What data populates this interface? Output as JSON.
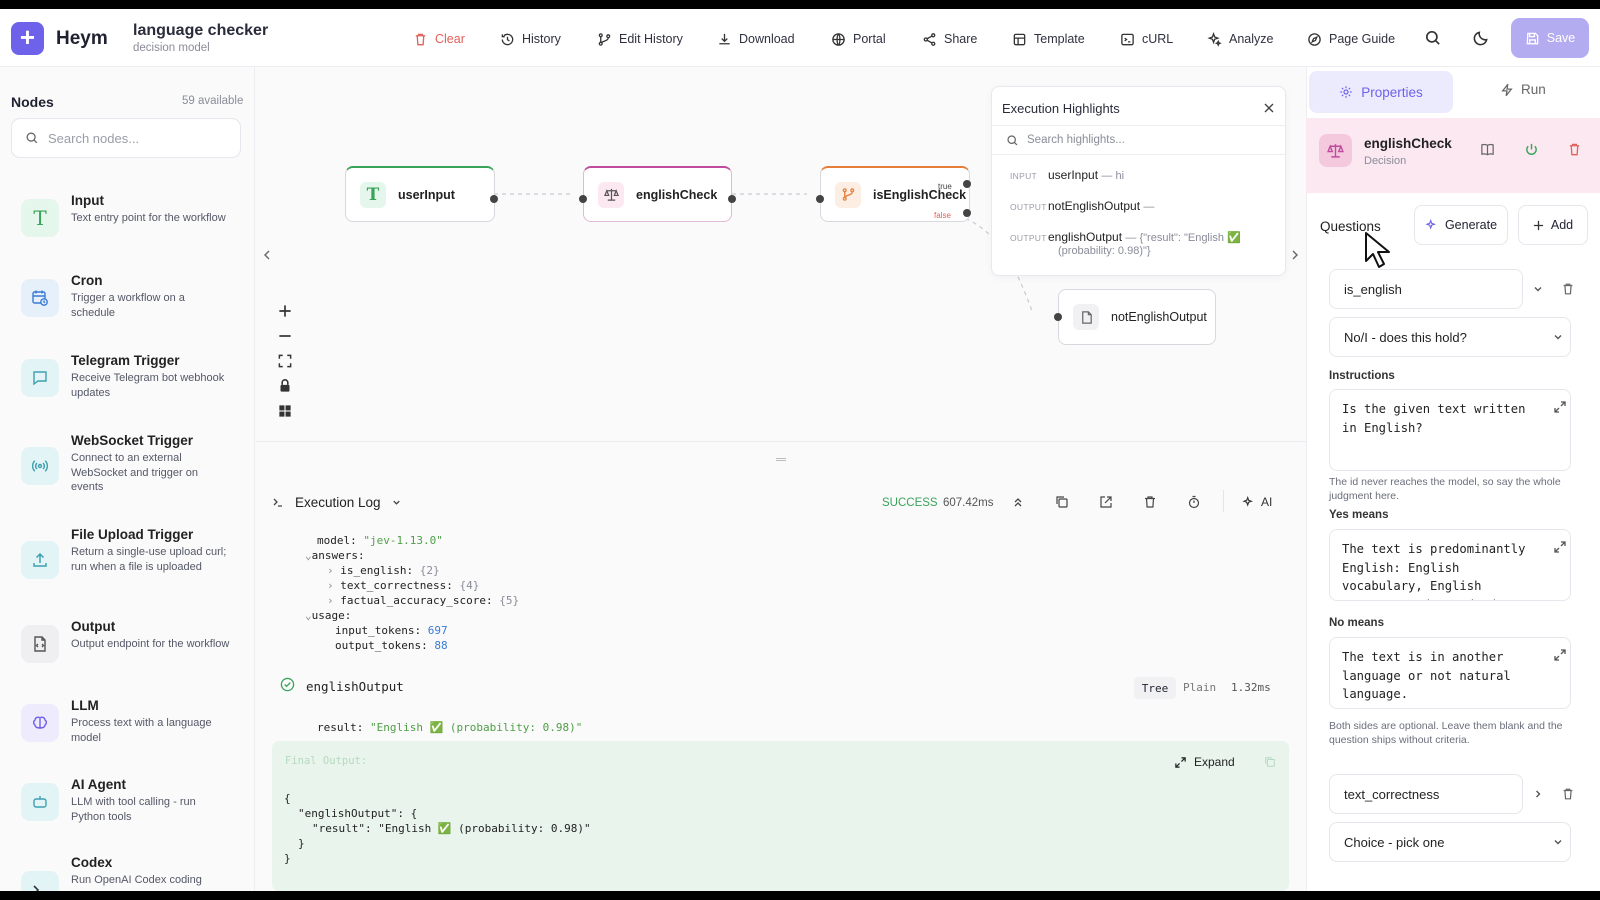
{
  "header": {
    "brand": "Heym",
    "workflow_title": "language checker",
    "workflow_subtitle": "decision model",
    "toolbar": {
      "clear": "Clear",
      "history": "History",
      "edit_history": "Edit History",
      "download": "Download",
      "portal": "Portal",
      "share": "Share",
      "template": "Template",
      "curl": "cURL",
      "analyze": "Analyze",
      "page_guide": "Page Guide",
      "save": "Save"
    }
  },
  "sidebar": {
    "title": "Nodes",
    "count": "59 available",
    "search_placeholder": "Search nodes...",
    "nodes": [
      {
        "title": "Input",
        "desc": "Text entry point for the workflow",
        "icon": "text-icon"
      },
      {
        "title": "Cron",
        "desc": "Trigger a workflow on a schedule",
        "icon": "calendar-clock-icon"
      },
      {
        "title": "Telegram Trigger",
        "desc": "Receive Telegram bot webhook updates",
        "icon": "chat-icon"
      },
      {
        "title": "WebSocket Trigger",
        "desc": "Connect to an external WebSocket and trigger on events",
        "icon": "broadcast-icon"
      },
      {
        "title": "File Upload Trigger",
        "desc": "Return a single-use upload curl; run when a file is uploaded",
        "icon": "upload-icon"
      },
      {
        "title": "Output",
        "desc": "Output endpoint for the workflow",
        "icon": "file-icon"
      },
      {
        "title": "LLM",
        "desc": "Process text with a language model",
        "icon": "brain-icon"
      },
      {
        "title": "AI Agent",
        "desc": "LLM with tool calling - run Python tools",
        "icon": "bot-icon"
      },
      {
        "title": "Codex",
        "desc": "Run OpenAI Codex coding",
        "icon": "terminal-icon"
      }
    ]
  },
  "canvas": {
    "nodes": {
      "user_input": "userInput",
      "english_check": "englishCheck",
      "is_english_check": "isEnglishCheck",
      "not_english_output": "notEnglishOutput"
    },
    "branch_true": "true",
    "branch_false": "false"
  },
  "highlights": {
    "title": "Execution Highlights",
    "search_placeholder": "Search highlights...",
    "rows": [
      {
        "kind": "INPUT",
        "name": "userInput",
        "value": "— hi"
      },
      {
        "kind": "OUTPUT",
        "name": "notEnglishOutput",
        "value": "—"
      },
      {
        "kind": "OUTPUT",
        "name": "englishOutput",
        "value": "— {\"result\": \"English ✅",
        "value2": "(probability: 0.98)\"}"
      }
    ]
  },
  "log": {
    "title": "Execution Log",
    "status": "SUCCESS",
    "duration": "607.42ms",
    "ai": "AI",
    "tree": {
      "model_key": "model:",
      "model_val": "\"jev-1.13.0\"",
      "answers_key": "answers:",
      "a1_key": "is_english:",
      "a1_val": "{2}",
      "a2_key": "text_correctness:",
      "a2_val": "{4}",
      "a3_key": "factual_accuracy_score:",
      "a3_val": "{5}",
      "usage_key": "usage:",
      "in_key": "input_tokens:",
      "in_val": "697",
      "out_key": "output_tokens:",
      "out_val": "88"
    },
    "entry": {
      "name": "englishOutput",
      "view_tree": "Tree",
      "view_plain": "Plain",
      "time": "1.32ms",
      "result_key": "result:",
      "result_val": "\"English ✅ (probability: 0.98)\""
    },
    "final": {
      "label": "Final Output:",
      "expand": "Expand",
      "l1": "{",
      "l2": "\"englishOutput\": {",
      "l3": "\"result\": \"English ✅ (probability: 0.98)\"",
      "l4": "}",
      "l5": "}"
    }
  },
  "properties": {
    "tab_properties": "Properties",
    "tab_run": "Run",
    "node_name": "englishCheck",
    "node_type": "Decision",
    "questions_label": "Questions",
    "generate": "Generate",
    "add": "Add",
    "q1": {
      "id": "is_english",
      "type": "No/I - does this hold?",
      "instructions_label": "Instructions",
      "instructions": "Is the given text written in English?",
      "instructions_hint": "The id never reaches the model, so say the whole judgment here.",
      "yes_label": "Yes means",
      "yes_text": "The text is predominantly English: English vocabulary, English grammar, and standard",
      "no_label": "No means",
      "no_text": "The text is in another language or not natural language.",
      "optional_hint": "Both sides are optional. Leave them blank and the question ships without criteria."
    },
    "q2": {
      "id": "text_correctness",
      "type": "Choice - pick one"
    }
  },
  "colors": {
    "accent": "#6e62ea",
    "success": "#3aa35a",
    "danger": "#e0605a"
  }
}
